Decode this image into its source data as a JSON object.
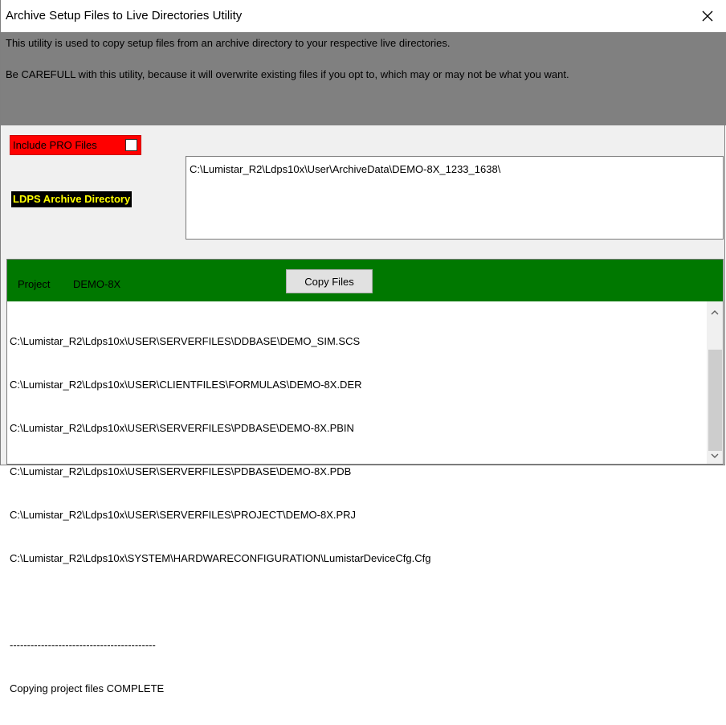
{
  "window": {
    "title": "Archive Setup Files to Live Directories Utility"
  },
  "info": {
    "line1": "This utility is used to copy setup files from an archive directory to your respective live directories.",
    "line2": "Be CAREFULL with this utility, because it will overwrite existing files if you opt to, which may or may not be what you want."
  },
  "pro_files": {
    "label": "Include PRO Files",
    "checked": false
  },
  "archive": {
    "label": "LDPS Archive Directory",
    "path": "C:\\Lumistar_R2\\Ldps10x\\User\\ArchiveData\\DEMO-8X_1233_1638\\"
  },
  "project": {
    "label": "Project",
    "value": "DEMO-8X",
    "copy_button": "Copy Files"
  },
  "log": {
    "lines": [
      "C:\\Lumistar_R2\\Ldps10x\\USER\\SERVERFILES\\DDBASE\\DEMO_SIM.SCS",
      "C:\\Lumistar_R2\\Ldps10x\\USER\\CLIENTFILES\\FORMULAS\\DEMO-8X.DER",
      "C:\\Lumistar_R2\\Ldps10x\\USER\\SERVERFILES\\PDBASE\\DEMO-8X.PBIN",
      "C:\\Lumistar_R2\\Ldps10x\\USER\\SERVERFILES\\PDBASE\\DEMO-8X.PDB",
      "C:\\Lumistar_R2\\Ldps10x\\USER\\SERVERFILES\\PROJECT\\DEMO-8X.PRJ",
      "C:\\Lumistar_R2\\Ldps10x\\SYSTEM\\HARDWARECONFIGURATION\\LumistarDeviceCfg.Cfg",
      "",
      "------------------------------------------",
      "Copying project files COMPLETE"
    ]
  },
  "colors": {
    "info_bg": "#808080",
    "pro_bg": "#ff0000",
    "archive_label_fg": "#ffff00",
    "project_bar": "#007800"
  },
  "icons": {
    "close": "close-icon",
    "scroll_up": "chevron-up-icon",
    "scroll_down": "chevron-down-icon"
  }
}
